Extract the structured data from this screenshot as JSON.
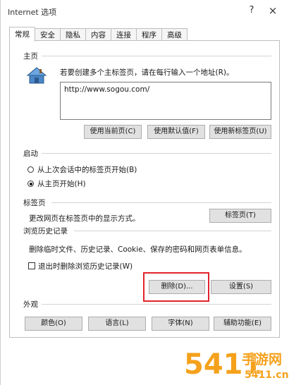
{
  "window": {
    "title": "Internet 选项",
    "help_label": "?",
    "close_label": "×"
  },
  "tabs": [
    {
      "label": "常规",
      "active": true
    },
    {
      "label": "安全",
      "active": false
    },
    {
      "label": "隐私",
      "active": false
    },
    {
      "label": "内容",
      "active": false
    },
    {
      "label": "连接",
      "active": false
    },
    {
      "label": "程序",
      "active": false
    },
    {
      "label": "高级",
      "active": false
    }
  ],
  "homepage": {
    "group_label": "主页",
    "description": "若要创建多个主标签页，请在每行输入一个地址(R)。",
    "url_value": "http://www.sogou.com/",
    "buttons": {
      "use_current": "使用当前页(C)",
      "use_default": "使用默认值(F)",
      "use_new_tab": "使用新标签页(U)"
    }
  },
  "startup": {
    "group_label": "启动",
    "options": [
      {
        "label": "从上次会话中的标签页开始(B)",
        "checked": false
      },
      {
        "label": "从主页开始(H)",
        "checked": true
      }
    ]
  },
  "tabs_section": {
    "group_label": "标签页",
    "description": "更改网页在标签页中的显示方式。",
    "button": "标签页(T)"
  },
  "history": {
    "group_label": "浏览历史记录",
    "description": "删除临时文件、历史记录、Cookie、保存的密码和网页表单信息。",
    "checkbox_label": "退出时删除浏览历史记录(W)",
    "checkbox_checked": false,
    "delete_button": "删除(D)...",
    "settings_button": "设置(S)"
  },
  "appearance": {
    "group_label": "外观",
    "buttons": {
      "colors": "颜色(O)",
      "languages": "语言(L)",
      "fonts": "字体(N)",
      "accessibility": "辅助功能(E)"
    }
  },
  "watermark": {
    "logo_text": "5411",
    "site_name": "手游网",
    "domain": "5411.cn"
  },
  "colors": {
    "highlight": "#e0242b",
    "watermark_orange": "#f5a11c",
    "button_face": "#e1e1e1"
  }
}
